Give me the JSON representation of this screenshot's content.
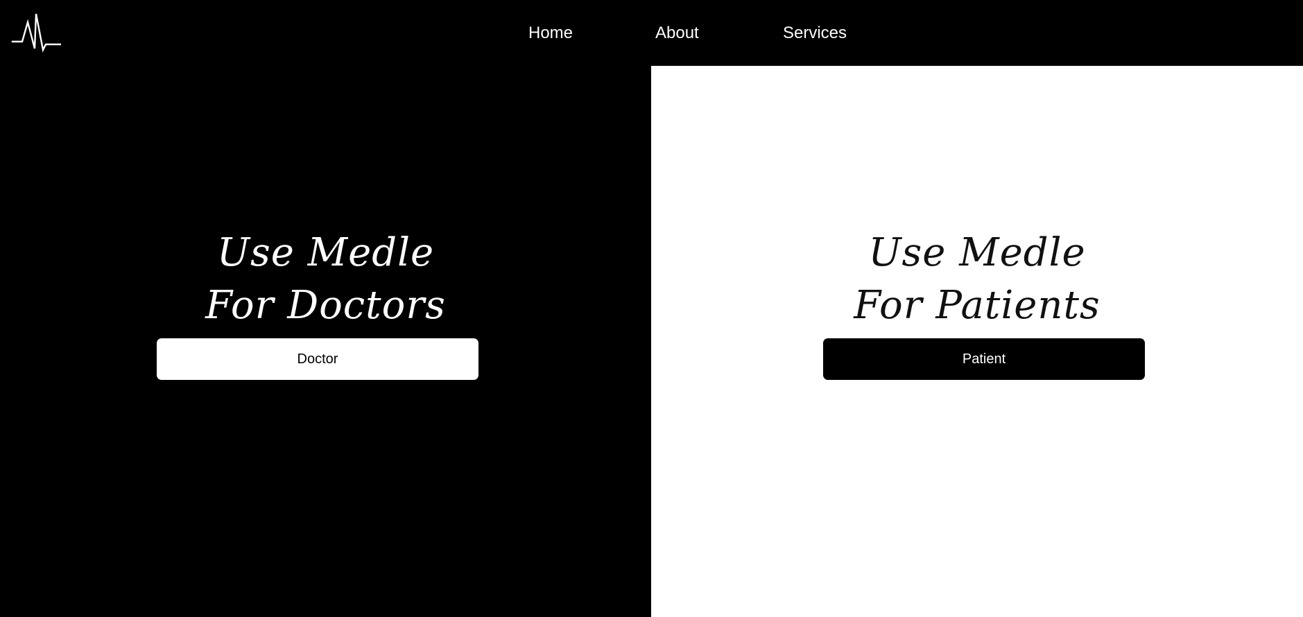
{
  "header": {
    "logo_icon": "heartbeat-pulse-icon",
    "nav": [
      {
        "label": "Home"
      },
      {
        "label": "About"
      },
      {
        "label": "Services"
      }
    ]
  },
  "doctors": {
    "tagline_line1": "Use Medle",
    "tagline_line2": "For Doctors",
    "button_label": "Doctor"
  },
  "patients": {
    "tagline_line1": "Use Medle",
    "tagline_line2": "For Patients",
    "button_label": "Patient"
  },
  "colors": {
    "dark": "#000000",
    "light": "#ffffff"
  }
}
